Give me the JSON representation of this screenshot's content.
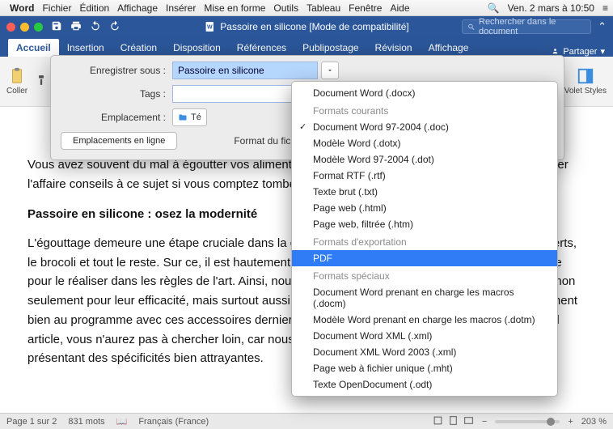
{
  "mac_menu": {
    "app": "Word",
    "items": [
      "Fichier",
      "Édition",
      "Affichage",
      "Insérer",
      "Mise en forme",
      "Outils",
      "Tableau",
      "Fenêtre",
      "Aide"
    ],
    "clock": "Ven. 2 mars à 10:50"
  },
  "titlebar": {
    "doc_title": "Passoire en silicone [Mode de compatibilité]",
    "search_placeholder": "Rechercher dans le document"
  },
  "ribbon": {
    "tabs": [
      "Accueil",
      "Insertion",
      "Création",
      "Disposition",
      "Références",
      "Publipostage",
      "Révision",
      "Affichage"
    ],
    "active_index": 0,
    "share_label": "Partager",
    "paste_label": "Coller",
    "styles_label": "Volet Styles"
  },
  "dialog": {
    "save_as_label": "Enregistrer sous :",
    "save_as_value": "Passoire en silicone",
    "tags_label": "Tags :",
    "tags_value": "",
    "location_label": "Emplacement :",
    "location_value": "Té",
    "online_locations_btn": "Emplacements en ligne",
    "file_format_label": "Format du fichier"
  },
  "format_menu": {
    "top_item": "Document Word (.docx)",
    "group1_header": "Formats courants",
    "group1": [
      "Document Word 97-2004 (.doc)",
      "Modèle Word (.dotx)",
      "Modèle Word 97-2004 (.dot)",
      "Format RTF (.rtf)",
      "Texte brut (.txt)",
      "Page web (.html)",
      "Page web, filtrée (.htm)"
    ],
    "group2_header": "Formats d'exportation",
    "group2_highlight": "PDF",
    "group3_header": "Formats spéciaux",
    "group3": [
      "Document Word prenant en charge les macros (.docm)",
      "Modèle Word prenant en charge les macros (.dotm)",
      "Document Word XML (.xml)",
      "Document XML Word 2003 (.xml)",
      "Page web à fichier unique (.mht)",
      "Texte OpenDocument (.odt)"
    ]
  },
  "document": {
    "p1": "Vous avez souvent du mal à égoutter vos aliments avec une passoire en silicone pour vous simplifier l'affaire conseils à ce sujet si vous comptez tomber sur",
    "h2": "Passoire en silicone : osez la modernité",
    "p2": "L'égouttage demeure une étape cruciale dans la cuisine, les spaghettis, les nouilles, les haricots verts, le brocoli et tout le reste. Sur ce, il est hautement préférable d'avoir à sa disposition le bon ustensile pour le réaliser dans les règles de l'art. Ainsi, nous vous recommandons les passoires en silicone, non seulement pour leur efficacité, mais surtout aussi pour leur praticité. La modernité se révèle également bien au programme avec ces accessoires derniers cris. Si vous êtes convaincue par l'achat d'un tel article, vous n'aurez pas à chercher loin, car nous avons sélectionné pour vous quelques modèles présentant des spécificités bien attrayantes."
  },
  "statusbar": {
    "page": "Page 1 sur 2",
    "words": "831 mots",
    "language": "Français (France)",
    "zoom": "203 %"
  }
}
